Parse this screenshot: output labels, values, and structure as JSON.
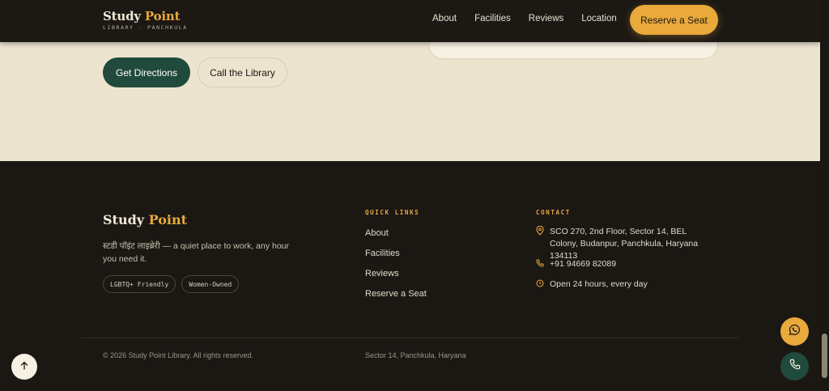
{
  "location_section": {
    "directions_button": "Get Directions",
    "call_button": "Call the Library"
  },
  "nav": {
    "logo_part1": "Study",
    "logo_part2": "Point",
    "logo_sub": "LIBRARY · PANCHKULA",
    "links": [
      "About",
      "Facilities",
      "Reviews",
      "Location"
    ],
    "cta": "Reserve a Seat"
  },
  "footer": {
    "logo_part1": "Study",
    "logo_part2": "Point",
    "tagline": "स्टडी पॉइंट लाइब्रेरी — a quiet place to work, any hour you need it.",
    "badges": [
      "LGBTQ+ Friendly",
      "Women-Owned"
    ],
    "quick_links_heading": "QUICK LINKS",
    "quick_links": [
      "About",
      "Facilities",
      "Reviews",
      "Reserve a Seat"
    ],
    "contact_heading": "CONTACT",
    "contact": {
      "address": "SCO 270, 2nd Floor, Sector 14, BEL Colony, Budanpur, Panchkula, Haryana 134113",
      "phone": "+91 94669 82089",
      "hours": "Open 24 hours, every day"
    },
    "copyright": "© 2026 Study Point Library. All rights reserved.",
    "area": "Sector 14, Panchkula, Haryana"
  },
  "icons": {
    "address": "map-pin-icon",
    "phone": "phone-icon",
    "hours": "clock-icon",
    "back_to_top": "arrow-up-icon",
    "whatsapp": "whatsapp-icon",
    "call": "phone-icon"
  },
  "colors": {
    "accent": "#e9a93b",
    "dark": "#1b1814",
    "green": "#204a3b",
    "cream": "#ece4ce"
  }
}
